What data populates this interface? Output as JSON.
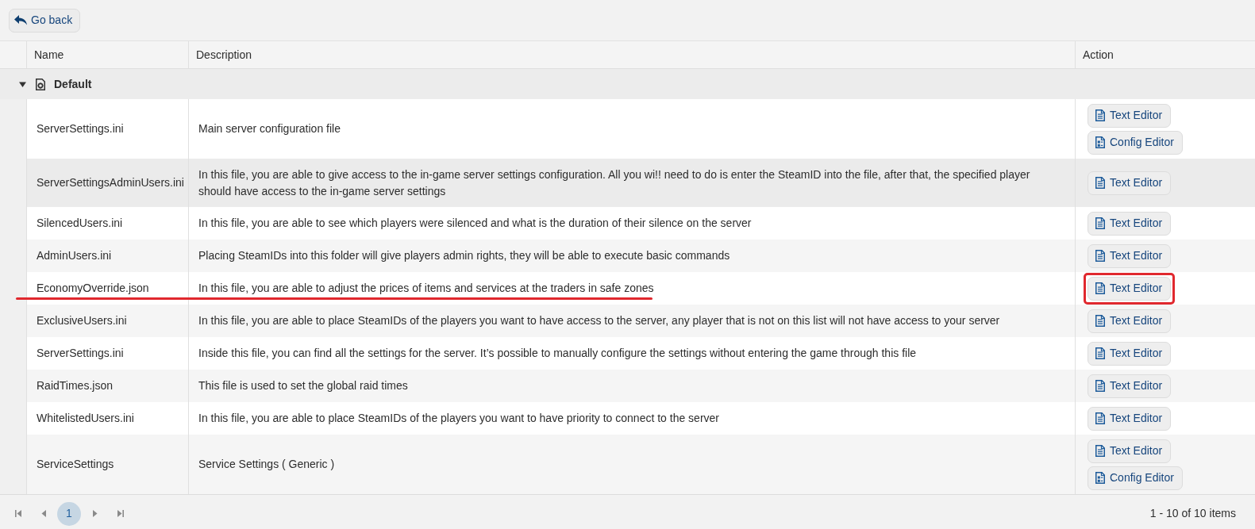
{
  "toolbar": {
    "back_button": "Go back"
  },
  "table": {
    "columns": [
      "Name",
      "Description",
      "Action"
    ],
    "groups": [
      {
        "label": "Default",
        "expanded": true,
        "rows": [
          {
            "name": "ServerSettings.ini",
            "description": "Main server configuration file",
            "hovered": false,
            "underlined": false,
            "actions": [
              {
                "kind": "text",
                "label": "Text Editor",
                "highlighted": false
              },
              {
                "kind": "config",
                "label": "Config Editor",
                "highlighted": false
              }
            ]
          },
          {
            "name": "ServerSettingsAdminUsers.ini",
            "description": "In this file, you are able to give access to the in-game server settings configuration. All you wi!! need to do is enter the SteamID into the file, after that, the specified player should have access to the in-game server settings",
            "hovered": true,
            "underlined": false,
            "actions": [
              {
                "kind": "text",
                "label": "Text Editor",
                "highlighted": false
              }
            ]
          },
          {
            "name": "SilencedUsers.ini",
            "description": "In this file, you are able to see which players were silenced and what is the duration of their silence on the server",
            "hovered": false,
            "underlined": false,
            "actions": [
              {
                "kind": "text",
                "label": "Text Editor",
                "highlighted": false
              }
            ]
          },
          {
            "name": "AdminUsers.ini",
            "description": "Placing SteamIDs into this folder will give players admin rights, they will be able to execute basic commands",
            "hovered": false,
            "underlined": false,
            "actions": [
              {
                "kind": "text",
                "label": "Text Editor",
                "highlighted": false
              }
            ]
          },
          {
            "name": "EconomyOverride.json",
            "description": "In this file, you are able to adjust the prices of items and services at the traders in safe zones",
            "hovered": false,
            "underlined": true,
            "actions": [
              {
                "kind": "text",
                "label": "Text Editor",
                "highlighted": true
              }
            ]
          },
          {
            "name": "ExclusiveUsers.ini",
            "description": "In this file, you are able to place SteamIDs of the players you want to have access to the server, any player that is not on this list will not have access to your server",
            "hovered": false,
            "underlined": false,
            "actions": [
              {
                "kind": "text",
                "label": "Text Editor",
                "highlighted": false
              }
            ]
          },
          {
            "name": "ServerSettings.ini",
            "description": "Inside this file, you can find all the settings for the server. It’s possible to manually configure the settings without entering the game through this file",
            "hovered": false,
            "underlined": false,
            "actions": [
              {
                "kind": "text",
                "label": "Text Editor",
                "highlighted": false
              }
            ]
          },
          {
            "name": "RaidTimes.json",
            "description": "This file is used to set the global raid times",
            "hovered": false,
            "underlined": false,
            "actions": [
              {
                "kind": "text",
                "label": "Text Editor",
                "highlighted": false
              }
            ]
          },
          {
            "name": "WhitelistedUsers.ini",
            "description": "In this file, you are able to place SteamIDs of the players you want to have priority to connect to the server",
            "hovered": false,
            "underlined": false,
            "actions": [
              {
                "kind": "text",
                "label": "Text Editor",
                "highlighted": false
              }
            ]
          },
          {
            "name": "ServiceSettings",
            "description": "Service Settings ( Generic )",
            "hovered": false,
            "underlined": false,
            "actions": [
              {
                "kind": "text",
                "label": "Text Editor",
                "highlighted": false
              },
              {
                "kind": "config",
                "label": "Config Editor",
                "highlighted": false
              }
            ]
          }
        ]
      }
    ]
  },
  "pager": {
    "pages": [
      {
        "label": "1",
        "selected": true
      }
    ],
    "summary": "1 - 10 of 10 items"
  }
}
